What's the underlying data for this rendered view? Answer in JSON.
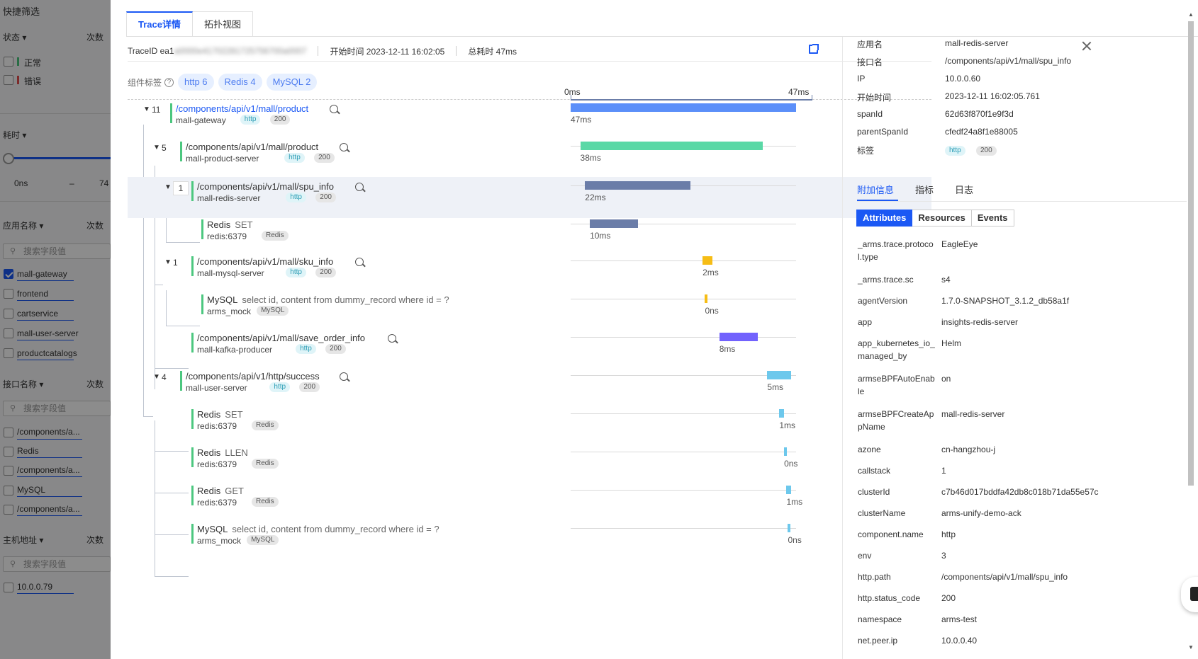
{
  "left_panel": {
    "title": "快捷筛选",
    "status_head": "状态 ▾",
    "count_head": "次数",
    "status_items": [
      {
        "label": "正常",
        "color": "#4cc77f"
      },
      {
        "label": "错误",
        "color": "#e34d4d"
      }
    ],
    "duration_head": "耗时 ▾",
    "duration_min": "0ns",
    "duration_dash": "–",
    "duration_max": "74",
    "app_head": "应用名称 ▾",
    "app_search_placeholder": "搜索字段值",
    "app_items": [
      "mall-gateway",
      "frontend",
      "cartservice",
      "mall-user-server",
      "productcatalogs"
    ],
    "interface_head": "接口名称 ▾",
    "interface_search_placeholder": "搜索字段值",
    "interface_items": [
      "/components/a...",
      "Redis",
      "/components/a...",
      "MySQL",
      "/components/a..."
    ],
    "host_head": "主机地址 ▾",
    "host_search_placeholder": "搜索字段值",
    "host_items": [
      "10.0.0.79"
    ]
  },
  "tabs": [
    "Trace详情",
    "拓扑视图"
  ],
  "trace_meta": {
    "trace_id_label": "TraceID ea1",
    "trace_id_blur": "a0000e41702281725756700a0007",
    "start_time": "开始时间 2023-12-11 16:02:05",
    "total_time": "总耗时 47ms"
  },
  "component_tags": {
    "label": "组件标签",
    "tags": [
      "http 6",
      "Redis 4",
      "MySQL 2"
    ]
  },
  "axis": {
    "start": "0ms",
    "end": "47ms"
  },
  "total_ms": 47,
  "spans": [
    {
      "count": "11",
      "title": "/components/api/v1/mall/product",
      "sub": "mall-gateway",
      "badges": [
        "http",
        "200"
      ],
      "start": 0,
      "dur": 47,
      "dur_label": "47ms",
      "color": "#5b8ff9",
      "link": true,
      "zoom": true
    },
    {
      "count": "5",
      "title": "/components/api/v1/mall/product",
      "sub": "mall-product-server",
      "badges": [
        "http",
        "200"
      ],
      "start": 2,
      "dur": 38,
      "dur_label": "38ms",
      "color": "#5ad8a6",
      "zoom": true
    },
    {
      "count": "1",
      "title": "/components/api/v1/mall/spu_info",
      "sub": "mall-redis-server",
      "badges": [
        "http",
        "200"
      ],
      "start": 3,
      "dur": 22,
      "dur_label": "22ms",
      "color": "#6b7da8",
      "zoom": true,
      "selected": true
    },
    {
      "title": "Redis",
      "op": "SET",
      "sub": "redis:6379",
      "badges": [
        "Redis"
      ],
      "start": 4,
      "dur": 10,
      "dur_label": "10ms",
      "color": "#6b7da8"
    },
    {
      "count": "1",
      "title": "/components/api/v1/mall/sku_info",
      "sub": "mall-mysql-server",
      "badges": [
        "http",
        "200"
      ],
      "start": 27.5,
      "dur": 2,
      "dur_label": "2ms",
      "color": "#f6bd16",
      "zoom": true
    },
    {
      "title": "MySQL",
      "op": "select id, content from dummy_record where id = ?",
      "sub": "arms_mock",
      "badges": [
        "MySQL"
      ],
      "start": 28,
      "dur": 0.4,
      "dur_label": "0ns",
      "color": "#f6bd16"
    },
    {
      "title": "/components/api/v1/mall/save_order_info",
      "sub": "mall-kafka-producer",
      "badges": [
        "http",
        "200"
      ],
      "start": 31,
      "dur": 8,
      "dur_label": "8ms",
      "color": "#7262fd",
      "zoom": true
    },
    {
      "count": "4",
      "title": "/components/api/v1/http/success",
      "sub": "mall-user-server",
      "badges": [
        "http",
        "200"
      ],
      "start": 41,
      "dur": 5,
      "dur_label": "5ms",
      "color": "#6dc8ec",
      "zoom": true
    },
    {
      "title": "Redis",
      "op": "SET",
      "sub": "redis:6379",
      "badges": [
        "Redis"
      ],
      "start": 43.5,
      "dur": 1,
      "dur_label": "1ms",
      "color": "#6dc8ec"
    },
    {
      "title": "Redis",
      "op": "LLEN",
      "sub": "redis:6379",
      "badges": [
        "Redis"
      ],
      "start": 44.5,
      "dur": 0.4,
      "dur_label": "0ns",
      "color": "#6dc8ec"
    },
    {
      "title": "Redis",
      "op": "GET",
      "sub": "redis:6379",
      "badges": [
        "Redis"
      ],
      "start": 45,
      "dur": 1,
      "dur_label": "1ms",
      "color": "#6dc8ec"
    },
    {
      "title": "MySQL",
      "op": "select id, content from dummy_record where id = ?",
      "sub": "arms_mock",
      "badges": [
        "MySQL"
      ],
      "start": 45.3,
      "dur": 0.4,
      "dur_label": "0ns",
      "color": "#6dc8ec"
    }
  ],
  "detail": {
    "basic": [
      {
        "key": "应用名",
        "value": "mall-redis-server"
      },
      {
        "key": "接口名",
        "value": "/components/api/v1/mall/spu_info"
      },
      {
        "key": "IP",
        "value": "10.0.0.60"
      },
      {
        "key": "开始时间",
        "value": "2023-12-11 16:02:05.761"
      },
      {
        "key": "spanId",
        "value": "62d63f870f1e9f3d"
      },
      {
        "key": "parentSpanId",
        "value": "cfedf24a8f1e88005"
      },
      {
        "key": "标签",
        "value": ""
      }
    ],
    "tag_badges": [
      "http",
      "200"
    ],
    "tabs": [
      "附加信息",
      "指标",
      "日志"
    ],
    "segments": [
      "Attributes",
      "Resources",
      "Events"
    ],
    "attributes": [
      {
        "key": "_arms.trace.protocol.type",
        "value": "EagleEye"
      },
      {
        "key": "_arms.trace.sc",
        "value": "s4"
      },
      {
        "key": "agentVersion",
        "value": "1.7.0-SNAPSHOT_3.1.2_db58a1f"
      },
      {
        "key": "app",
        "value": "insights-redis-server"
      },
      {
        "key": "app_kubernetes_io_managed_by",
        "value": "Helm"
      },
      {
        "key": "armseBPFAutoEnable",
        "value": "on"
      },
      {
        "key": "armseBPFCreateAppName",
        "value": "mall-redis-server"
      },
      {
        "key": "azone",
        "value": "cn-hangzhou-j"
      },
      {
        "key": "callstack",
        "value": "1"
      },
      {
        "key": "clusterId",
        "value": "c7b46d017bddfa42db8c018b71da55e57c"
      },
      {
        "key": "clusterName",
        "value": "arms-unify-demo-ack"
      },
      {
        "key": "component.name",
        "value": "http"
      },
      {
        "key": "env",
        "value": "3"
      },
      {
        "key": "http.path",
        "value": "/components/api/v1/mall/spu_info"
      },
      {
        "key": "http.status_code",
        "value": "200"
      },
      {
        "key": "namespace",
        "value": "arms-test"
      },
      {
        "key": "net.peer.ip",
        "value": "10.0.0.40"
      }
    ]
  }
}
